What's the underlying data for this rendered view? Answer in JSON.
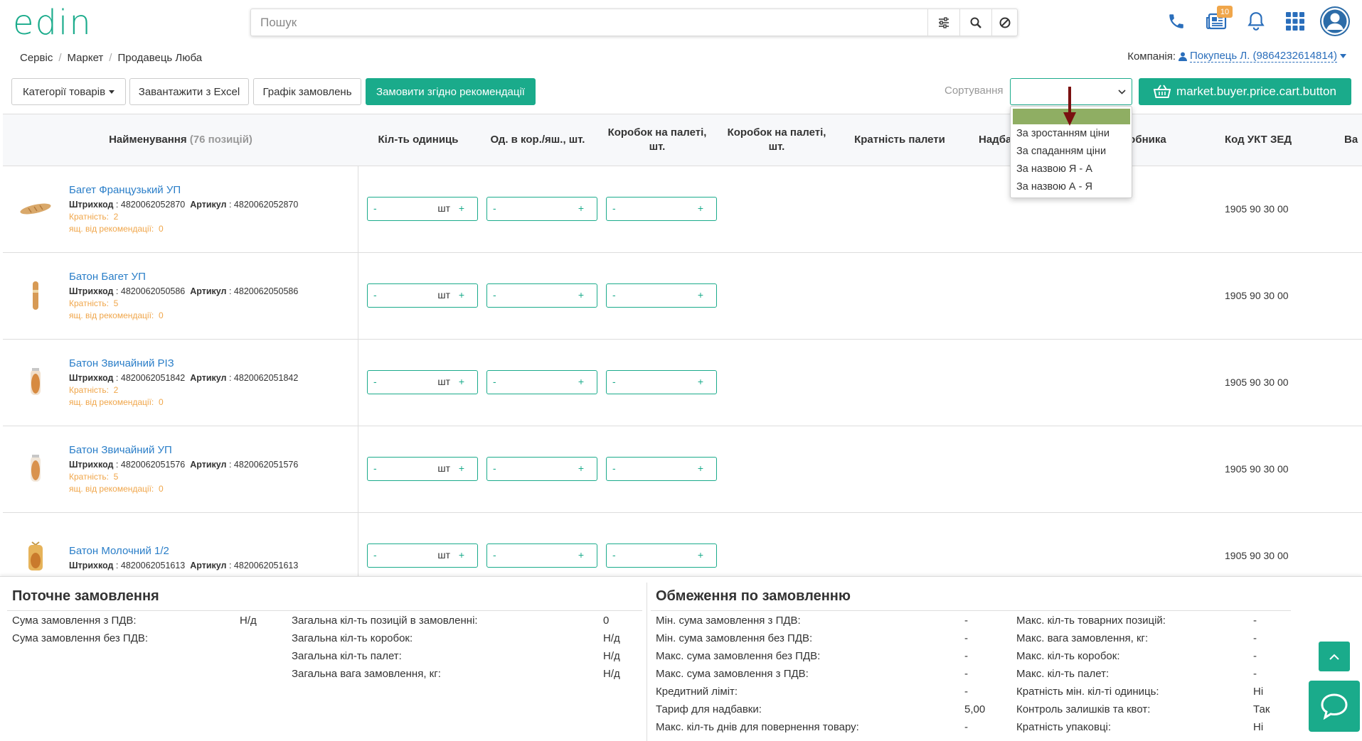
{
  "header": {
    "logo": "edin",
    "search_placeholder": "Пошук",
    "notifications_badge": "10"
  },
  "breadcrumb": [
    "Сервіс",
    "Маркет",
    "Продавець Люба"
  ],
  "company": {
    "label": "Компанія:",
    "value": "Покупець Л. (9864232614814)"
  },
  "toolbar": {
    "categories": "Категорії товарів",
    "upload_excel": "Завантажити з Excel",
    "order_schedule": "Графік замовлень",
    "order_by_recommendation": "Замовити згідно рекомендації",
    "sort_label": "Сортування",
    "sort_value": "",
    "cart_button": "market.buyer.price.cart.button"
  },
  "sort_options": [
    "",
    "За зростанням ціни",
    "За спаданням ціни",
    "За назвою Я - А",
    "За назвою А - Я"
  ],
  "table": {
    "headers": {
      "name": "Найменування",
      "count": "(76 позицій)",
      "qty_units": "Кіл-ть одиниць",
      "units_per_box": "Од. в кор./яш., шт.",
      "boxes_per_pallet_1": "Коробок на палеті, шт.",
      "boxes_per_pallet_2": "Коробок на палеті, шт.",
      "pallet_multiplicity": "Кратність палети",
      "markup": "Надба",
      "manufacturer": "робника",
      "ukt": "Код УКТ ЗЕД",
      "extra": "Ва"
    },
    "labels": {
      "barcode": "Штрихкод",
      "article": "Артикул",
      "multiplicity": "Кратність:",
      "rec_boxes": "ящ. від рекомендації:",
      "minus": "-",
      "plus": "+",
      "unit": "шт"
    },
    "rows": [
      {
        "name": "Багет Французький УП",
        "barcode": "4820062052870",
        "article": "4820062052870",
        "multiplicity": "2",
        "rec": "0",
        "ukt": "1905 90 30 00"
      },
      {
        "name": "Батон Багет УП",
        "barcode": "4820062050586",
        "article": "4820062050586",
        "multiplicity": "5",
        "rec": "0",
        "ukt": "1905 90 30 00"
      },
      {
        "name": "Батон Звичайний РІЗ",
        "barcode": "4820062051842",
        "article": "4820062051842",
        "multiplicity": "2",
        "rec": "0",
        "ukt": "1905 90 30 00"
      },
      {
        "name": "Батон Звичайний УП",
        "barcode": "4820062051576",
        "article": "4820062051576",
        "multiplicity": "5",
        "rec": "0",
        "ukt": "1905 90 30 00"
      },
      {
        "name": "Батон Молочний 1/2",
        "barcode": "4820062051613",
        "article": "4820062051613",
        "multiplicity": "",
        "rec": "",
        "ukt": "1905 90 30 00"
      }
    ]
  },
  "current_order": {
    "title": "Поточне замовлення",
    "left": [
      {
        "label": "Сума замовлення з ПДВ:",
        "value": "Н/д"
      },
      {
        "label": "Сума замовлення без ПДВ:",
        "value": ""
      }
    ],
    "right": [
      {
        "label": "Загальна кіл-ть позицій в замовленні:",
        "value": "0"
      },
      {
        "label": "Загальна кіл-ть коробок:",
        "value": "Н/д"
      },
      {
        "label": "Загальна кіл-ть палет:",
        "value": "Н/д"
      },
      {
        "label": "Загальна вага замовлення, кг:",
        "value": "Н/д"
      }
    ]
  },
  "order_limits": {
    "title": "Обмеження по замовленню",
    "left": [
      {
        "label": "Мін. сума замовлення з ПДВ:",
        "value": "-"
      },
      {
        "label": "Мін. сума замовлення без ПДВ:",
        "value": "-"
      },
      {
        "label": "Макс. сума замовлення без ПДВ:",
        "value": "-"
      },
      {
        "label": "Макс. сума замовлення з ПДВ:",
        "value": "-"
      },
      {
        "label": "Кредитний ліміт:",
        "value": "-"
      },
      {
        "label": "Тариф для надбавки:",
        "value": "5,00"
      },
      {
        "label": "Макс. кіл-ть днів для повернення товару:",
        "value": "-"
      }
    ],
    "right": [
      {
        "label": "Макс. кіл-ть товарних позицій:",
        "value": "-"
      },
      {
        "label": "Макс. вага замовлення, кг:",
        "value": "-"
      },
      {
        "label": "Макс. кіл-ть коробок:",
        "value": "-"
      },
      {
        "label": "Макс. кіл-ть палет:",
        "value": "-"
      },
      {
        "label": "Кратність мін. кіл-ті одиниць:",
        "value": "Ні"
      },
      {
        "label": "Контроль залишків та квот:",
        "value": "Так"
      },
      {
        "label": "Кратність упаковці:",
        "value": "Ні"
      }
    ]
  },
  "colors": {
    "accent": "#1aab8b",
    "link": "#2a7ec8",
    "orange": "#f0a64a",
    "highlight": "#8fae63",
    "arrow": "#7a1010"
  }
}
